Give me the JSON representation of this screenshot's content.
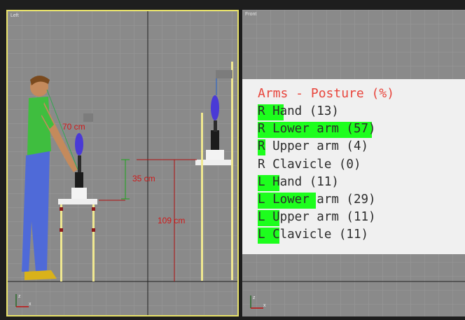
{
  "viewports": {
    "left_label": "Left",
    "front_label": "Front"
  },
  "measurements": {
    "reach": "70 cm",
    "height_diff": "35 cm",
    "table_height": "109 cm"
  },
  "axes": {
    "z": "z",
    "x": "x"
  },
  "panel": {
    "title": "Arms - Posture (%)",
    "rows": [
      {
        "label": "R Hand (13)",
        "value": 13
      },
      {
        "label": "R Lower arm (57)",
        "value": 57
      },
      {
        "label": "R Upper arm (4)",
        "value": 4
      },
      {
        "label": "R Clavicle (0)",
        "value": 0
      },
      {
        "label": "L Hand (11)",
        "value": 11
      },
      {
        "label": "L Lower arm (29)",
        "value": 29
      },
      {
        "label": "L Upper arm (11)",
        "value": 11
      },
      {
        "label": "L Clavicle (11)",
        "value": 11
      }
    ]
  },
  "colors": {
    "bar": "#1dfe1d",
    "title": "#e8453c",
    "dimension": "#d01818",
    "active_viewport_border": "#e8e26a"
  }
}
